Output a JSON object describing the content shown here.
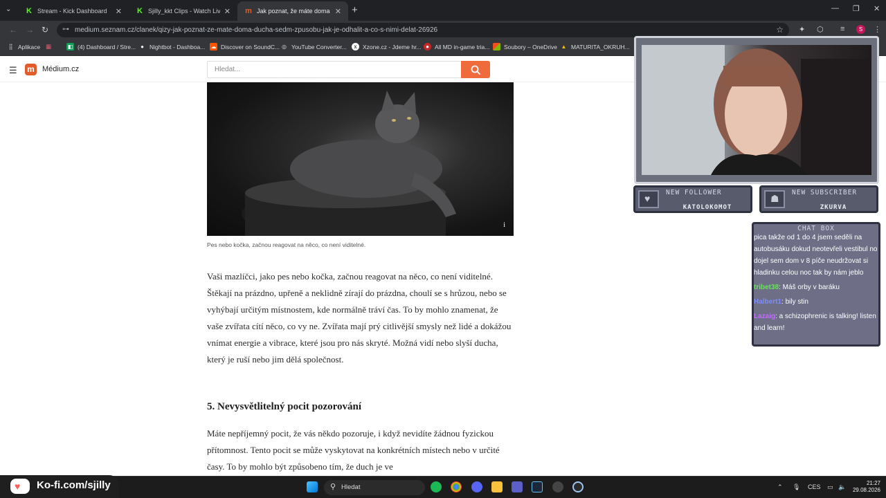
{
  "browser": {
    "tabs": [
      {
        "label": "Stream - Kick Dashboard",
        "icon": "kick-icon"
      },
      {
        "label": "Sjilly_kkt Clips - Watch Live on Kick",
        "icon": "kick-icon"
      },
      {
        "label": "Jak poznat, že máte doma ducha",
        "icon": "medium-icon"
      }
    ],
    "url": "medium.seznam.cz/clanek/qizy-jak-poznat-ze-mate-doma-ducha-sedm-zpusobu-jak-je-odhalit-a-co-s-nimi-delat-26926",
    "profile_initial": "S",
    "bookmarks": [
      "Aplikace",
      "(4) Dashboard / Stre...",
      "Nightbot - Dashboa...",
      "Discover on SoundC...",
      "YouTube Converter...",
      "Xzone.cz - Jdeme hr...",
      "All MD in-game tria...",
      "Soubory – OneDrive",
      "MATURITA_OKRUH..."
    ]
  },
  "site": {
    "name": "Médium.cz",
    "search_placeholder": "Hledat...",
    "image_caption": "Pes nebo kočka, začnou reagovat na něco, co není viditelné.",
    "paragraph_1": "Vaši mazlíčci, jako pes nebo kočka, začnou reagovat na něco, co není viditelné. Štěkají na prázdno, upřeně a neklidně zírají do prázdna, choulí se s hrůzou, nebo se vyhýbají určitým místnostem, kde normálně tráví čas. To by mohlo znamenat, že vaše zvířata cítí něco, co vy ne. Zvířata mají prý citlivější smysly než lidé a dokážou vnímat energie a vibrace, které jsou pro nás skryté. Možná vidí nebo slyší ducha, který je ruší nebo jim dělá společnost.",
    "heading_5": "5. Nevysvětlitelný pocit pozorování",
    "paragraph_2": "Máte nepříjemný pocit, že vás někdo pozoruje, i když nevidíte žádnou fyzickou přítomnost. Tento pocit se může vyskytovat na konkrétních místech nebo v určité časy. To by mohlo být způsobeno tím, že duch je ve"
  },
  "overlay": {
    "new_follower_title": "NEW FOLLOWER",
    "new_follower_name": "KATOLOKOMOT",
    "new_subscriber_title": "NEW SUBSCRIBER",
    "new_subscriber_name": "ZKURVA",
    "chat_title": "CHAT BOX",
    "chat_messages": [
      {
        "user": "",
        "text": "pica takže od 1 do 4 jsem seděli na autobusáku dokud neotevřeli vestibul no dojel sem dom v 8 píče neudržovat si hladinku celou noc tak by nám jeblo"
      },
      {
        "user": "tribet38",
        "text": ": Máš orby v baráku"
      },
      {
        "user": "Halbert1",
        "text": ": bily stin"
      },
      {
        "user": "Lazaig",
        "text": ": a schizophrenic is talking! listen and learn!"
      }
    ]
  },
  "taskbar": {
    "kofi": "Ko-fi.com/sjilly",
    "search": "Hledat",
    "language": "CES",
    "time": "21:27",
    "date": "29.08.2026"
  }
}
